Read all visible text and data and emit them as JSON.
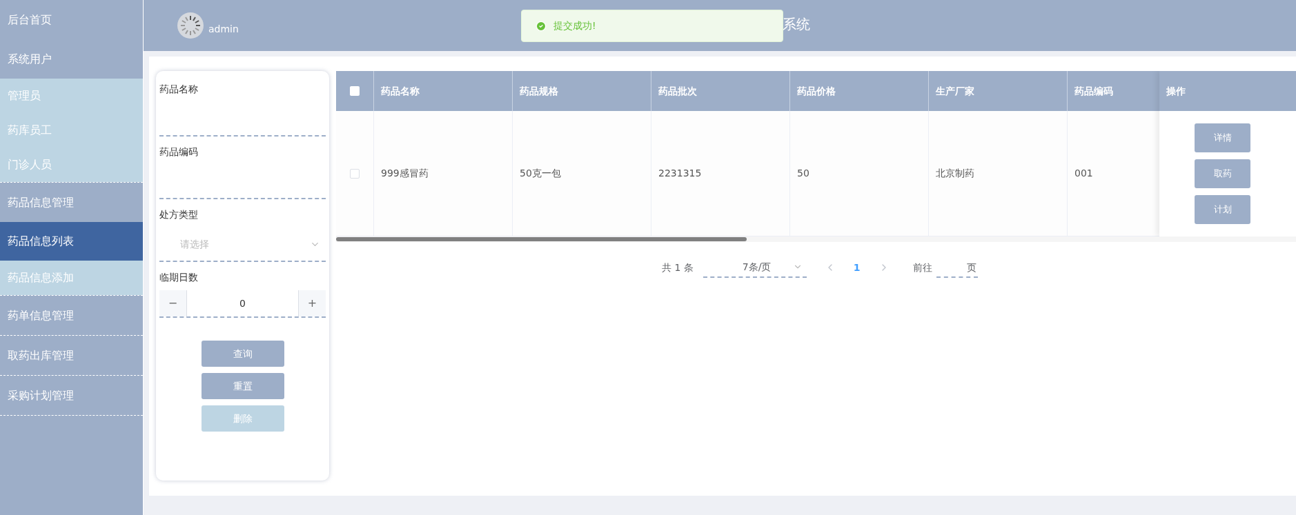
{
  "sidebar": {
    "items": [
      {
        "label": "后台首页",
        "selected": false
      },
      {
        "label": "系统用户",
        "selected": false,
        "expanded": true,
        "children": [
          {
            "label": "管理员",
            "selected": false
          },
          {
            "label": "药库员工",
            "selected": false
          },
          {
            "label": "门诊人员",
            "selected": false
          }
        ]
      },
      {
        "label": "药品信息管理",
        "selected": false,
        "expanded": true,
        "children": [
          {
            "label": "药品信息列表",
            "selected": true
          },
          {
            "label": "药品信息添加",
            "selected": false
          }
        ]
      },
      {
        "label": "药单信息管理",
        "selected": false
      },
      {
        "label": "取药出库管理",
        "selected": false
      },
      {
        "label": "采购计划管理",
        "selected": false
      }
    ]
  },
  "header": {
    "user": "admin",
    "title": "系统"
  },
  "toast": {
    "kind": "success",
    "message": "提交成功!"
  },
  "filter": {
    "fields": [
      {
        "kind": "text",
        "label": "药品名称"
      },
      {
        "kind": "text",
        "label": "药品编码"
      },
      {
        "kind": "select",
        "label": "处方类型",
        "placeholder": "请选择"
      },
      {
        "kind": "number",
        "label": "临期日数",
        "value": "0",
        "minus": "−",
        "plus": "+"
      }
    ],
    "buttons": [
      {
        "label": "查询",
        "disabled": false
      },
      {
        "label": "重置",
        "disabled": false
      },
      {
        "label": "删除",
        "disabled": true
      }
    ]
  },
  "table": {
    "columns": [
      "药品名称",
      "药品规格",
      "药品批次",
      "药品价格",
      "生产厂家",
      "药品编码"
    ],
    "action_column": "操作",
    "header_checked": false,
    "rows": [
      {
        "checked": false,
        "cells": [
          "999感冒药",
          "50克一包",
          "2231315",
          "50",
          "北京制药",
          "001"
        ],
        "actions": [
          "详情",
          "取药",
          "计划"
        ]
      }
    ]
  },
  "pagination": {
    "total": "共 1 条",
    "page_size": "7条/页",
    "pages": [
      {
        "label": "1",
        "selected": true
      }
    ],
    "goto": "前往",
    "goto_suffix": "页"
  }
}
